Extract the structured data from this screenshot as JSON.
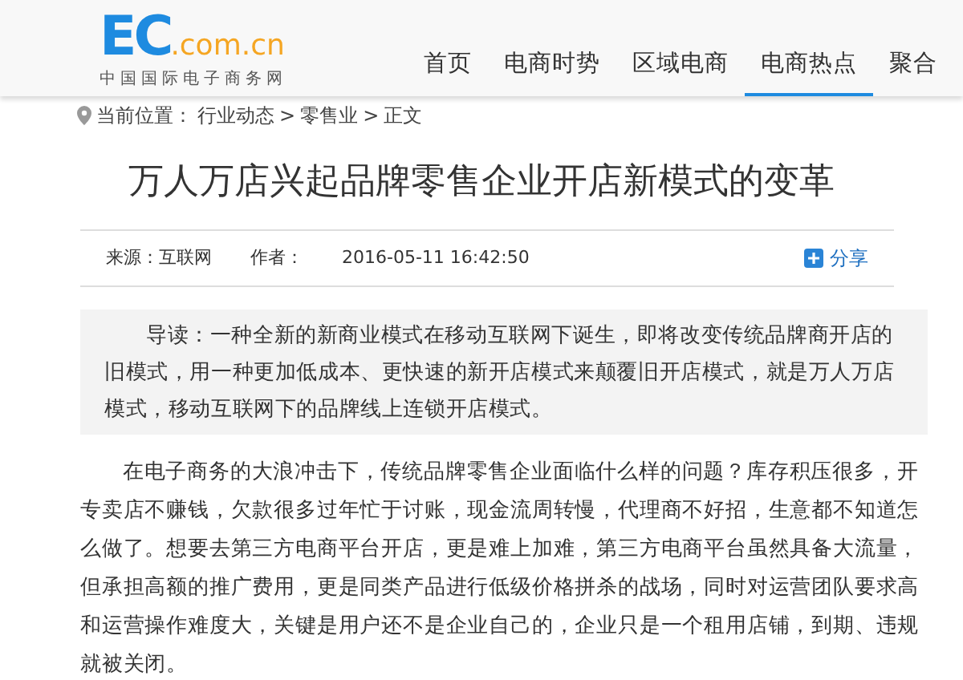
{
  "logo": {
    "brand": "EC",
    "domain": ".com.cn",
    "tagline": "中国国际电子商务网"
  },
  "nav": [
    {
      "label": "首页",
      "selected": false
    },
    {
      "label": "电商时势",
      "selected": false
    },
    {
      "label": "区域电商",
      "selected": false
    },
    {
      "label": "电商热点",
      "selected": true
    },
    {
      "label": "聚合",
      "selected": false
    }
  ],
  "breadcrumb": {
    "prefix": "当前位置：",
    "items": [
      "行业动态",
      "零售业",
      "正文"
    ],
    "separator": ">"
  },
  "article": {
    "title": "万人万店兴起品牌零售企业开店新模式的变革",
    "source": "来源：互联网",
    "author": "作者：",
    "date": "2016-05-11 16:42:50",
    "share": "分享",
    "lead": "导读：一种全新的新商业模式在移动互联网下诞生，即将改变传统品牌商开店的旧模式，用一种更加低成本、更快速的新开店模式来颠覆旧开店模式，就是万人万店模式，移动互联网下的品牌线上连锁开店模式。",
    "paragraphs": [
      "在电子商务的大浪冲击下，传统品牌零售企业面临什么样的问题？库存积压很多，开专卖店不赚钱，欠款很多过年忙于讨账，现金流周转慢，代理商不好招，生意都不知道怎么做了。想要去第三方电商平台开店，更是难上加难，第三方电商平台虽然具备大流量，但承担高额的推广费用，更是同类产品进行低级价格拼杀的战场，同时对运营团队要求高和运营操作难度大，关键是用户还不是企业自己的，企业只是一个租用店铺，到期、违规就被关闭。"
    ]
  }
}
